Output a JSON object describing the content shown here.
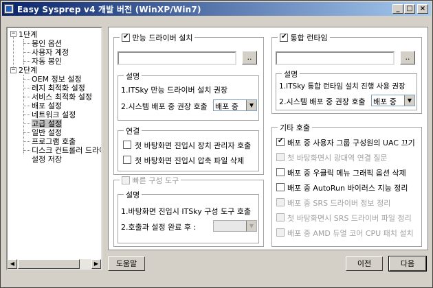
{
  "window": {
    "title": "Easy Sysprep v4 개발 버전 (WinXP/Win7)",
    "minimize": "_",
    "maximize": "□",
    "close": "×"
  },
  "tree": {
    "items": [
      {
        "label": "1단계",
        "expander": "−"
      },
      {
        "label": "봉인 옵션"
      },
      {
        "label": "사용자 계정"
      },
      {
        "label": "자동 봉인"
      },
      {
        "label": "2단계",
        "expander": "−"
      },
      {
        "label": "OEM 정보 설정"
      },
      {
        "label": "레지 최적화 설정"
      },
      {
        "label": "서비스 최적화 설정"
      },
      {
        "label": "배포 설정"
      },
      {
        "label": "네트워크 설정"
      },
      {
        "label": "고급 설정",
        "selected": true
      },
      {
        "label": "일반 설정"
      },
      {
        "label": "프로그램 호출"
      },
      {
        "label": "디스크 컨트롤러 드라이버"
      },
      {
        "label": "설정 저장"
      }
    ],
    "scroll_left": "◀",
    "scroll_right": "▶"
  },
  "driver": {
    "checkbox_label": "만능 드라이버 설치",
    "checked": true,
    "path_value": "",
    "browse_label": "..",
    "desc_title": "설명",
    "desc_line1": "1.ITSky 만능 드라이버 설치 권장",
    "desc_line2": "2.시스템 배포 중 권장 호출",
    "timing_value": "배포 중",
    "link_title": "연결",
    "link_opt1": "첫 바탕화면 진입시 장치 관리자 호출",
    "link_opt2": "첫 바탕화면 진입시 압축 파일 삭제"
  },
  "runtime": {
    "checkbox_label": "통합 런타임",
    "checked": true,
    "path_value": "",
    "browse_label": "..",
    "desc_title": "설명",
    "desc_line1": "1.ITSky 통합 런타임 설치 진행 사용 권장",
    "desc_line2": "2.시스템 배포 중 권장 호출",
    "timing_value": "배포 중"
  },
  "quick": {
    "checkbox_label": "빠른 구성 도구",
    "desc_title": "설명",
    "desc_line1": "1.바탕화면 진입시 ITSky 구성 도구 호출",
    "desc_line2": "2.호출과 설정 완료 후 :",
    "timing_value": ""
  },
  "other": {
    "title": "기타 호출",
    "options": [
      {
        "label": "배포 중 사용자 그룹 구성원의 UAC 끄기",
        "checked": true,
        "enabled": true
      },
      {
        "label": "첫 바탕화면시 광대역 연결 질문",
        "checked": false,
        "enabled": false
      },
      {
        "label": "배포 중 우클릭 메뉴 그래픽 옵션 삭제",
        "checked": false,
        "enabled": true
      },
      {
        "label": "배포 중 AutoRun 바이러스 지능 정리",
        "checked": false,
        "enabled": true
      },
      {
        "label": "배포 중 SRS 드라이버 정보 정리",
        "checked": false,
        "enabled": false
      },
      {
        "label": "첫 바탕화면시 SRS 드라이버 파일 정리",
        "checked": false,
        "enabled": false
      },
      {
        "label": "배포 중 AMD 듀얼 코어 CPU 패치 설치",
        "checked": false,
        "enabled": false
      }
    ]
  },
  "footer": {
    "help_label": "도움말",
    "prev_label": "이전",
    "next_label": "다음"
  }
}
